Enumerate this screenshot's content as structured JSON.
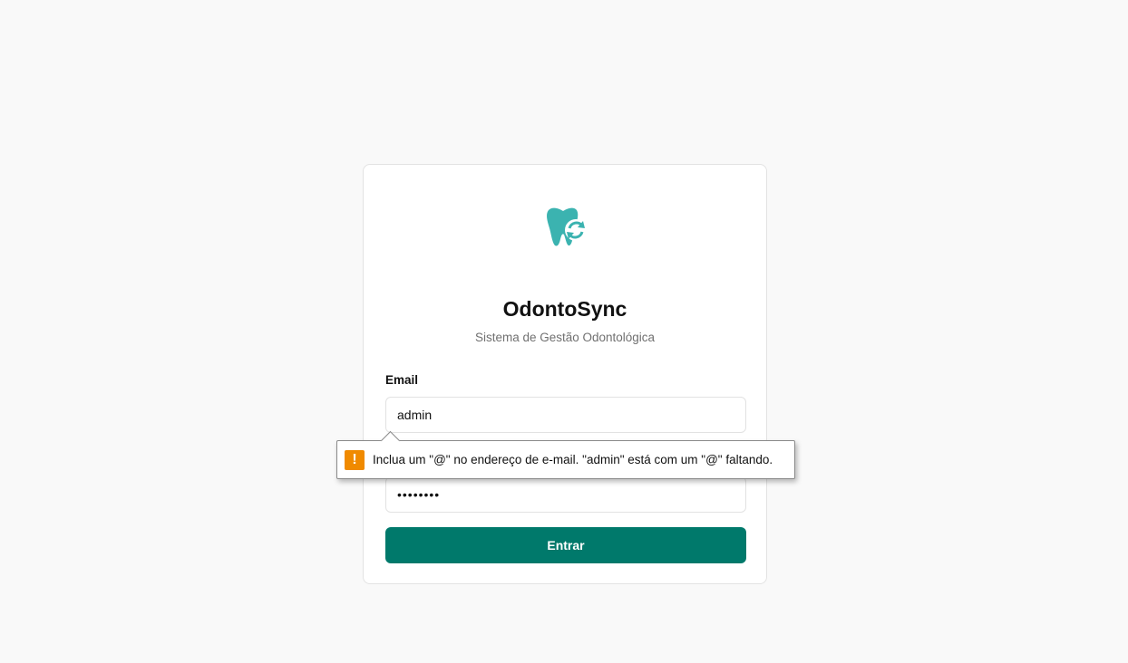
{
  "app": {
    "name": "OdontoSync",
    "subtitle": "Sistema de Gestão Odontológica",
    "logo_icon": "tooth-sync-icon",
    "accent_color": "#00796b",
    "logo_color": "#3bb3b0"
  },
  "form": {
    "email_label": "Email",
    "email_value": "admin",
    "password_value": "••••••••",
    "submit_label": "Entrar"
  },
  "validation": {
    "icon": "warning-icon",
    "message": "Inclua um \"@\" no endereço de e-mail. \"admin\" está com um \"@\" faltando."
  }
}
